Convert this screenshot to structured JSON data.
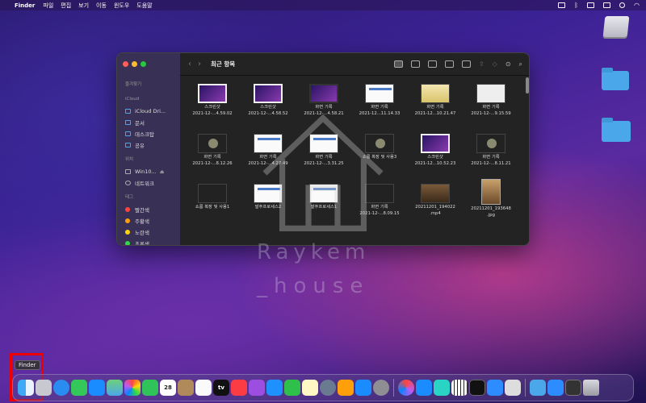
{
  "menubar": {
    "app_name": "Finder",
    "menus": [
      "파일",
      "편집",
      "보기",
      "이동",
      "윈도우",
      "도움말"
    ]
  },
  "finder": {
    "title": "최근 항목",
    "sidebar": {
      "favorites_header": "즐겨찾기",
      "icloud_header": "iCloud",
      "icloud_items": [
        "iCloud Dri...",
        "문서",
        "데스크탑",
        "공유"
      ],
      "locations_header": "위치",
      "location_items": [
        "Win10...",
        "네트워크"
      ],
      "tags_header": "태그",
      "tags": [
        {
          "label": "빨간색",
          "color": "#ff453a"
        },
        {
          "label": "주황색",
          "color": "#ff9f0a"
        },
        {
          "label": "노란색",
          "color": "#ffd60a"
        },
        {
          "label": "초록색",
          "color": "#32d74b"
        }
      ]
    },
    "files": [
      {
        "line1": "스크린샷",
        "line2": "2021-12-...4.59.02"
      },
      {
        "line1": "스크린샷",
        "line2": "2021-12-...4.58.52"
      },
      {
        "line1": "화면 기록",
        "line2": "2021-12-...4.58.21"
      },
      {
        "line1": "화면 기록",
        "line2": "2021-12...11.14.33"
      },
      {
        "line1": "화면 기록",
        "line2": "2021-12...10.21.47"
      },
      {
        "line1": "화면 기록",
        "line2": "2021-12-...9.15.59"
      },
      {
        "line1": "화면 기록",
        "line2": "2021-12-...8.12.26"
      },
      {
        "line1": "화면 기록",
        "line2": "2021-12-...4.27.49"
      },
      {
        "line1": "화면 기록",
        "line2": "2021-12-...3.31.25"
      },
      {
        "line1": "쇼룸 복장 및 사용3",
        "line2": ""
      },
      {
        "line1": "스크린샷",
        "line2": "2021-12...10.52.23"
      },
      {
        "line1": "화면 기록",
        "line2": "2021-12-...8.11.21"
      },
      {
        "line1": "쇼룸 복장 및 사용1",
        "line2": ""
      },
      {
        "line1": "발주프로세스2",
        "line2": ""
      },
      {
        "line1": "발주프로세스1",
        "line2": ""
      },
      {
        "line1": "화면 기록",
        "line2": "2021-12-...8.09.15"
      },
      {
        "line1": "20211201_194022",
        "line2": ".mp4"
      },
      {
        "line1": "20211201_193648",
        "line2": ".jpg"
      }
    ]
  },
  "watermark": {
    "line1": "Raykem",
    "line2": "_house"
  },
  "dock": {
    "tooltip": "Finder",
    "calendar_day": "28",
    "tv_label": "tv"
  }
}
